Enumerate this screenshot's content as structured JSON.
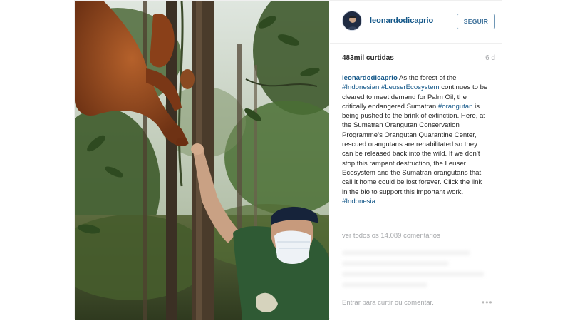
{
  "post": {
    "username": "leonardodicaprio",
    "follow_label": "SEGUIR",
    "likes": "483mil curtidas",
    "time_ago": "6 d",
    "caption": {
      "username": "leonardodicaprio",
      "p1": " As the forest of the ",
      "tag1": "#Indonesian",
      "p2": " ",
      "tag2": "#LeuserEcosystem",
      "p3": " continues to be cleared to meet demand for Palm Oil, the critically endangered Sumatran ",
      "tag3": "#orangutan",
      "p4": " is being pushed to the brink of extinction. Here, at the Sumatran Orangutan Conservation Programme’s Orangutan Quarantine Center, rescued orangutans are rehabilitated so they can be released back into the wild. If we don’t stop this rampant destruction, the Leuser Ecosystem and the Sumatran orangutans that call it home could be lost forever. Click the link in the bio to support this important work. ",
      "tag4": "#Indonesia"
    },
    "view_all_comments": "ver todos os 14.089 comentários",
    "comment_placeholder": "Entrar para curtir ou comentar.",
    "more_options": "•••",
    "icons": {
      "avatar": "profile-avatar",
      "more": "more-options-icon"
    }
  },
  "colors": {
    "link": "#125688",
    "follow_border": "#6f97b6",
    "muted": "#a5a7aa"
  }
}
